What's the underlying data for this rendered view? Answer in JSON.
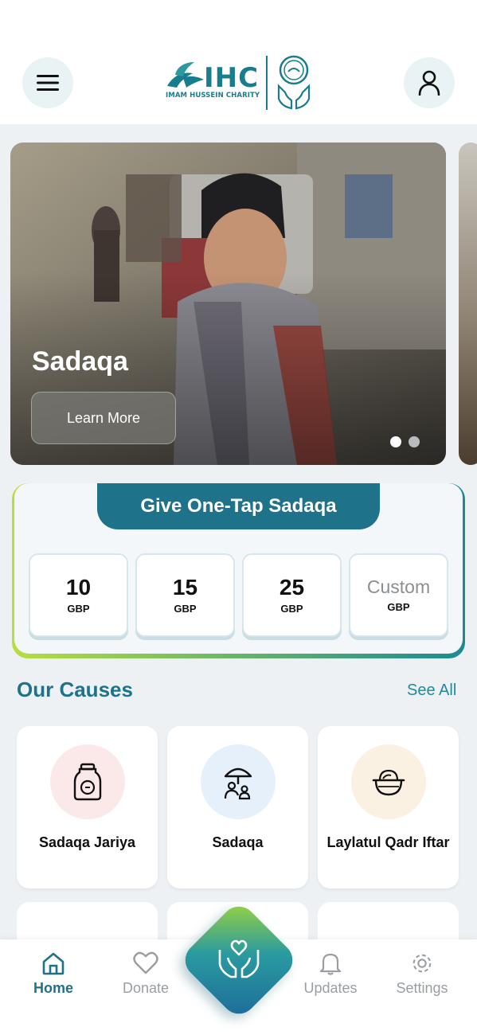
{
  "header": {
    "logo": {
      "text": "IHC",
      "subtitle": "IMAM HUSSEIN CHARITY"
    },
    "menu_icon": "hamburger-menu-icon",
    "profile_icon": "user-profile-icon"
  },
  "carousel": {
    "slides": [
      {
        "title": "Sadaqa",
        "button_label": "Learn More"
      }
    ],
    "active_index": 0,
    "dot_count": 2
  },
  "onetap": {
    "title": "Give One-Tap Sadaqa",
    "amounts": [
      {
        "value": "10",
        "currency": "GBP"
      },
      {
        "value": "15",
        "currency": "GBP"
      },
      {
        "value": "25",
        "currency": "GBP"
      },
      {
        "value": "Custom",
        "currency": "GBP"
      }
    ]
  },
  "causes": {
    "title": "Our Causes",
    "see_all": "See All",
    "items": [
      {
        "label": "Sadaqa Jariya",
        "icon": "jar-coin-icon",
        "color": "#fbe9ea"
      },
      {
        "label": "Sadaqa",
        "icon": "umbrella-family-icon",
        "color": "#e6f0fb"
      },
      {
        "label": "Laylatul Qadr Iftar",
        "icon": "food-basket-icon",
        "color": "#fbf1e3"
      }
    ]
  },
  "nav": {
    "items": [
      {
        "label": "Home",
        "icon": "home-icon",
        "active": true
      },
      {
        "label": "Donate",
        "icon": "heart-icon",
        "active": false
      },
      {
        "label": "Updates",
        "icon": "bell-icon",
        "active": false
      },
      {
        "label": "Settings",
        "icon": "gear-icon",
        "active": false
      }
    ],
    "center_icon": "heart-hands-icon"
  },
  "colors": {
    "brand": "#1e7289",
    "accent_green": "#b6de3e",
    "teal": "#1a7d8f"
  }
}
